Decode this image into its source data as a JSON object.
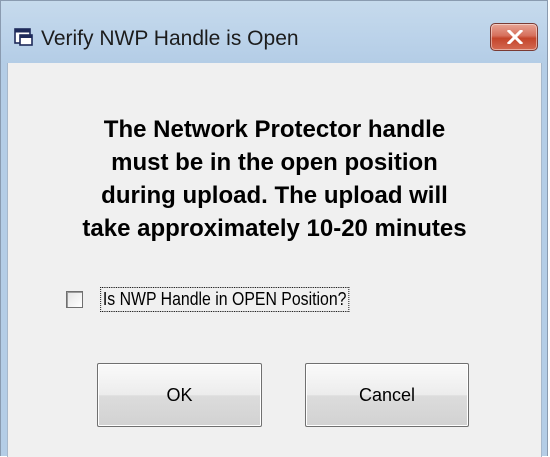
{
  "dialog": {
    "title": "Verify NWP Handle is Open",
    "message_lines": [
      "The Network Protector handle",
      "must be in the open position",
      "during upload.  The upload will",
      "take approximately 10-20 minutes"
    ],
    "checkbox": {
      "label": "Is NWP Handle in OPEN Position?",
      "checked": false
    },
    "buttons": {
      "ok_label": "OK",
      "cancel_label": "Cancel"
    }
  },
  "colors": {
    "titlebar": "#bcd3ea",
    "close_button": "#c4452b",
    "client_background": "#f0f0f0"
  },
  "icons": {
    "title_icon": "window-app-icon",
    "close_icon": "close-x-icon"
  }
}
